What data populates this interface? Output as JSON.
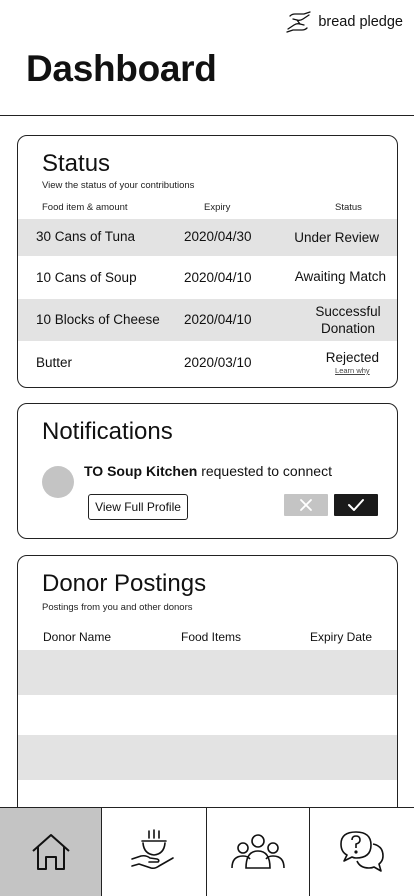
{
  "brand": {
    "name": "bread pledge",
    "icon": "hands-icon"
  },
  "page": {
    "title": "Dashboard"
  },
  "status": {
    "title": "Status",
    "subtitle": "View the status of your contributions",
    "columns": {
      "item": "Food item & amount",
      "expiry": "Expiry",
      "status": "Status"
    },
    "rows": [
      {
        "item": "30 Cans of Tuna",
        "expiry": "2020/04/30",
        "status": "Under Review",
        "shaded": true
      },
      {
        "item": "10 Cans of Soup",
        "expiry": "2020/04/10",
        "status": "Awaiting Match",
        "shaded": false
      },
      {
        "item": "10 Blocks of Cheese",
        "expiry": "2020/04/10",
        "status": "Successful Donation",
        "shaded": true
      },
      {
        "item": "Butter",
        "expiry": "2020/03/10",
        "status": "Rejected",
        "link": "Learn why",
        "shaded": false
      }
    ]
  },
  "notifications": {
    "title": "Notifications",
    "items": [
      {
        "from": "TO Soup Kitchen",
        "message": " requested to connect",
        "profile_button": "View Full Profile",
        "reject_icon": "close-icon",
        "accept_icon": "check-icon"
      }
    ]
  },
  "donor_postings": {
    "title": "Donor Postings",
    "subtitle": "Postings from you and other donors",
    "columns": {
      "name": "Donor Name",
      "items": "Food Items",
      "expiry": "Expiry Date"
    }
  },
  "nav": {
    "items": [
      {
        "icon": "home-icon",
        "active": true
      },
      {
        "icon": "food-bowl-icon",
        "active": false
      },
      {
        "icon": "community-icon",
        "active": false
      },
      {
        "icon": "help-chat-icon",
        "active": false
      }
    ]
  },
  "colors": {
    "shade": "#e3e3e3",
    "active_nav": "#c4c4c4",
    "accept": "#1a1a1a",
    "reject": "#c4c4c4"
  }
}
